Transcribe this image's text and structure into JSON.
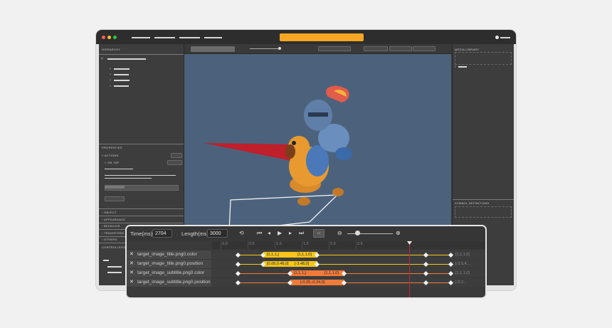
{
  "panels": {
    "hierarchy": "HIERARCHY",
    "properties": "PROPERTIES",
    "actions": "ACTIONS",
    "on_tap": "ON TAP",
    "sections": [
      "OBJECT",
      "APPEARANCE",
      "BEHAVIOR",
      "TRANSFORM",
      "OTHERS"
    ],
    "controllers": "CONTROLLERS",
    "media_library": "MEDIA LIBRARY",
    "symbol_definitions": "SYMBOL DEFINITIONS"
  },
  "colors": {
    "accent_orange": "#f5a623",
    "keyframe_yellow": "#f5c518",
    "keyframe_orange": "#f07a3a",
    "playhead_red": "#c8243a",
    "viewport_bg": "#4c627c"
  },
  "timeline": {
    "time_label": "Time(ms):",
    "time_value": "2704",
    "length_label": "Length(ms):",
    "length_value": "3000",
    "icons": [
      "loop-icon",
      "skip-start-icon",
      "step-back-icon",
      "play-icon",
      "step-forward-icon",
      "skip-end-icon",
      "fit-icon",
      "zoom-out-icon",
      "zoom-slider",
      "zoom-in-icon"
    ],
    "ruler": [
      "0.0",
      "0.5",
      "1.0",
      "1.5",
      "2.0",
      "2.5"
    ],
    "tracks": [
      {
        "name": "target_image_title.png0.color",
        "segment": [
          "[1,1,1,]",
          "[1,1,1,0]"
        ],
        "end_value": "[1,1,1,0]"
      },
      {
        "name": "target_image_title.png0.position",
        "segment": [
          "[0.08,0.48,0]",
          "[-3.48,0]"
        ],
        "end_value": "[-3.5,4..."
      },
      {
        "name": "target_image_subtitle.png0.color",
        "segment": [
          "[1,1,1,]",
          "[1,1,1,0]"
        ],
        "end_value": "[1,1,1,0]"
      },
      {
        "name": "target_image_subtitle.png0.position",
        "segment": [
          "[-0.25,-0.24,0]"
        ],
        "end_value": "[-0.2..."
      }
    ]
  }
}
